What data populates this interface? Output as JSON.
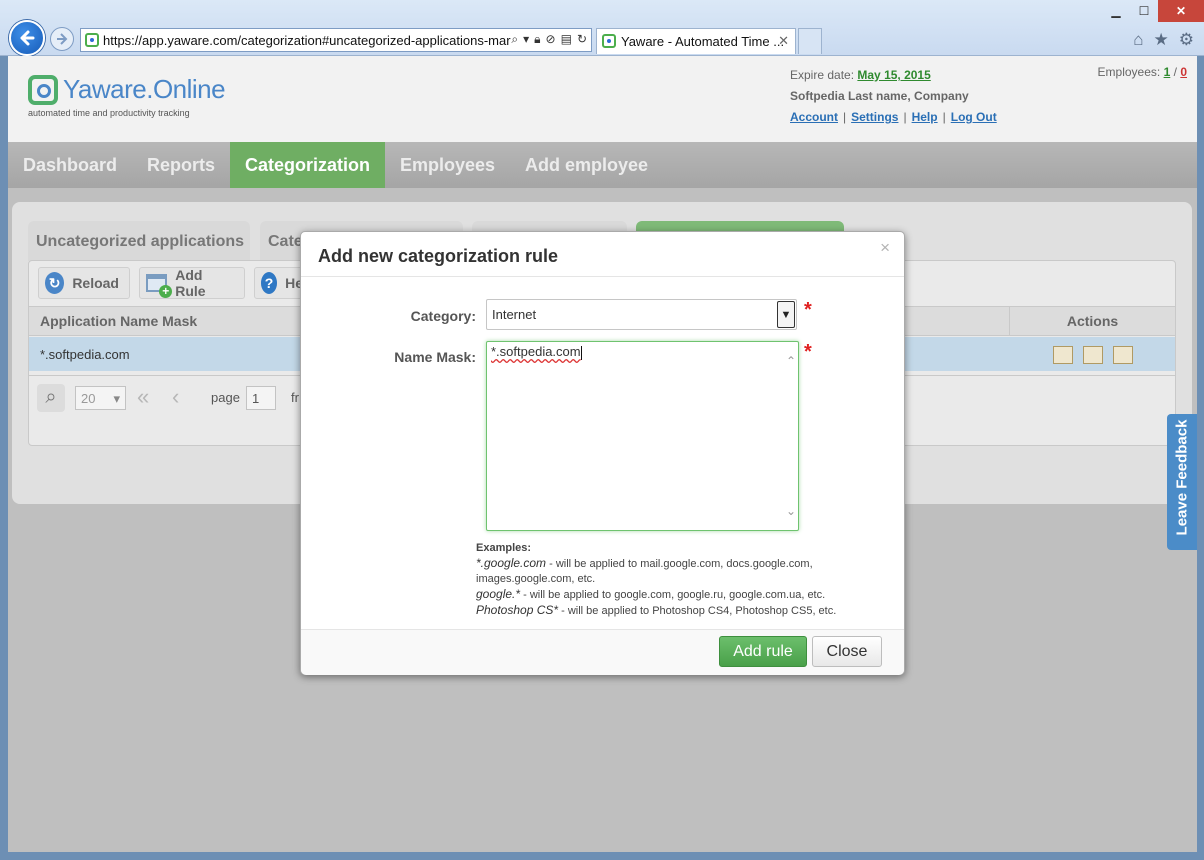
{
  "browser": {
    "url": "https://app.yaware.com/categorization#uncategorized-applications-mar",
    "tab_title": "Yaware - Automated Time ...",
    "tab_close": "✕",
    "win_minimize": "▁",
    "win_maximize": "☐",
    "win_close": "✕",
    "home": "⌂",
    "favorites": "★",
    "tools": "⚙"
  },
  "header": {
    "logo_text": "Yaware.Online",
    "tagline": "automated time and productivity tracking",
    "expire_label": "Expire date:",
    "expire_date": "May 15, 2015",
    "user_name": "Softpedia Last name, Company",
    "links": {
      "account": "Account",
      "settings": "Settings",
      "help": "Help",
      "logout": "Log Out"
    },
    "sep": "|",
    "employees_label": "Employees:",
    "employees_active": "1",
    "employees_slash": "/",
    "employees_inactive": "0"
  },
  "menu": {
    "dashboard": "Dashboard",
    "reports": "Reports",
    "categorization": "Categorization",
    "employees": "Employees",
    "add_employee": "Add employee"
  },
  "panel": {
    "tab_uncategorized": "Uncategorized applications",
    "tab_partial": "Cate",
    "toolbar": {
      "reload": "Reload",
      "add_rule": "Add Rule",
      "help_partial": "He"
    },
    "columns": {
      "mask": "Application Name Mask",
      "actions": "Actions"
    },
    "row_mask": "*.softpedia.com",
    "pager": {
      "page_size": "20",
      "page_label": "page",
      "page_value": "1",
      "from_partial": "fr"
    }
  },
  "feedback": "Leave Feedback",
  "modal": {
    "title": "Add new categorization rule",
    "close_x": "×",
    "category_label": "Category:",
    "category_value": "Internet",
    "name_mask_label": "Name Mask:",
    "name_mask_value": "*.softpedia.com",
    "required": "*",
    "examples_title": "Examples:",
    "ex1_pattern": "*.google.com",
    "ex1_text": " - will be applied to mail.google.com, docs.google.com, images.google.com, etc.",
    "ex2_pattern": "google.*",
    "ex2_text": " - will be applied to google.com, google.ru, google.com.ua, etc.",
    "ex3_pattern": "Photoshop CS*",
    "ex3_text": " - will be applied to Photoshop CS4, Photoshop CS5, etc.",
    "add_rule_button": "Add rule",
    "close_button": "Close"
  }
}
